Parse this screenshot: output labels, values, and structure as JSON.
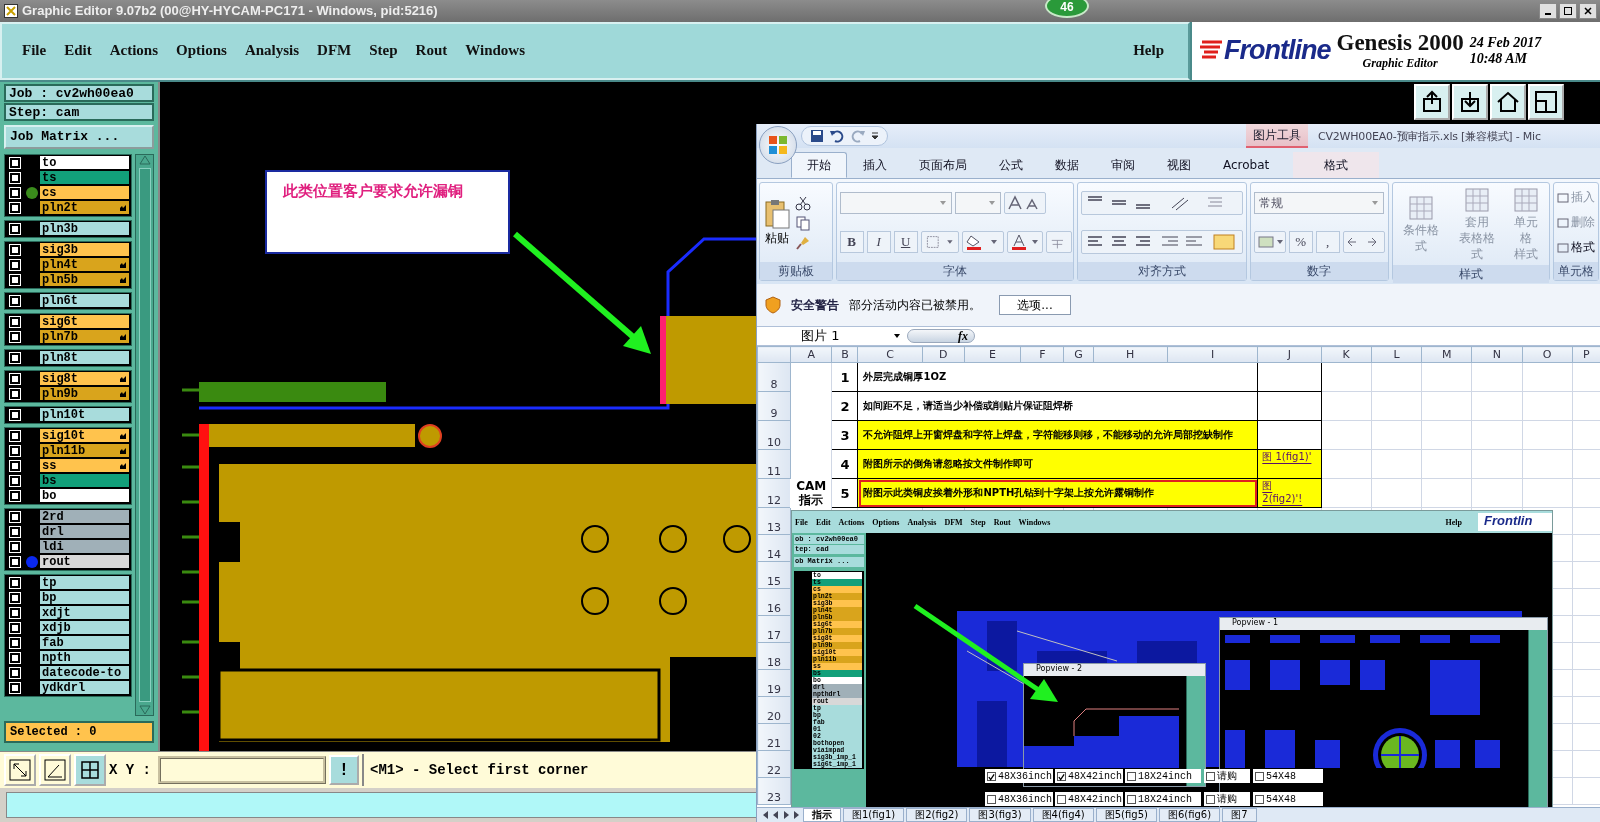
{
  "window": {
    "title": "Graphic Editor 9.07b2 (00@HY-HYCAM-PC171 - Windows, pid:5216)",
    "badge": "46"
  },
  "menu": [
    "File",
    "Edit",
    "Actions",
    "Options",
    "Analysis",
    "DFM",
    "Step",
    "Rout",
    "Windows"
  ],
  "help": "Help",
  "brand": {
    "logo": "Frontline",
    "product": "Genesis 2000",
    "subtitle": "Graphic Editor",
    "date": "24 Feb 2017",
    "time": "10:48 AM"
  },
  "job": "Job : cv2wh00ea0",
  "step": "Step: cam",
  "matrix_button": "Job Matrix ...",
  "layer_groups": [
    [
      {
        "name": "to",
        "color": "#ffffff",
        "checked": false,
        "flag": false
      },
      {
        "name": "ts",
        "color": "#12a07a",
        "checked": false,
        "flag": false
      },
      {
        "name": "cs",
        "color": "#ffc34d",
        "checked": false,
        "flag": false,
        "marker": {
          "color": "#3a8c1c"
        }
      },
      {
        "name": "pln2t",
        "color": "#d9a41c",
        "checked": false,
        "flag": true
      }
    ],
    [
      {
        "name": "pln3b",
        "color": "#a8dcdc",
        "checked": false,
        "flag": false
      }
    ],
    [
      {
        "name": "sig3b",
        "color": "#ffc34d",
        "checked": false,
        "flag": false
      },
      {
        "name": "pln4t",
        "color": "#d9a41c",
        "checked": false,
        "flag": true
      },
      {
        "name": "pln5b",
        "color": "#d9a41c",
        "checked": false,
        "flag": true
      }
    ],
    [
      {
        "name": "pln6t",
        "color": "#a8dcdc",
        "checked": false,
        "flag": false
      }
    ],
    [
      {
        "name": "sig6t",
        "color": "#ffc34d",
        "checked": false,
        "flag": false
      },
      {
        "name": "pln7b",
        "color": "#d9a41c",
        "checked": false,
        "flag": true
      }
    ],
    [
      {
        "name": "pln8t",
        "color": "#a8dcdc",
        "checked": false,
        "flag": false
      }
    ],
    [
      {
        "name": "sig8t",
        "color": "#ffc34d",
        "checked": false,
        "flag": true
      },
      {
        "name": "pln9b",
        "color": "#d9a41c",
        "checked": false,
        "flag": true
      }
    ],
    [
      {
        "name": "pln10t",
        "color": "#a8dcdc",
        "checked": false,
        "flag": false
      }
    ],
    [
      {
        "name": "sig10t",
        "color": "#ffc34d",
        "checked": false,
        "flag": true
      },
      {
        "name": "pln11b",
        "color": "#d9a41c",
        "checked": false,
        "flag": true
      },
      {
        "name": "ss",
        "color": "#ffc34d",
        "checked": false,
        "flag": true
      },
      {
        "name": "bs",
        "color": "#12a07a",
        "checked": false,
        "flag": false
      },
      {
        "name": "bo",
        "color": "#ffffff",
        "checked": false,
        "flag": false
      }
    ],
    [
      {
        "name": "2rd",
        "color": "#a0b0b8",
        "checked": false,
        "flag": false
      },
      {
        "name": "drl",
        "color": "#a0b0b8",
        "checked": false,
        "flag": false
      },
      {
        "name": "ldi",
        "color": "#a0b0b8",
        "checked": false,
        "flag": false
      },
      {
        "name": "rout",
        "color": "#d8d8d8",
        "checked": false,
        "flag": false,
        "marker": {
          "color": "#0a28f0"
        }
      }
    ],
    [
      {
        "name": "tp",
        "color": "#a8dcdc",
        "checked": false,
        "flag": false
      },
      {
        "name": "bp",
        "color": "#a8dcdc",
        "checked": false,
        "flag": false
      },
      {
        "name": "xdjt",
        "color": "#a8dcdc",
        "checked": false,
        "flag": false
      },
      {
        "name": "xdjb",
        "color": "#a8dcdc",
        "checked": false,
        "flag": false
      },
      {
        "name": "fab",
        "color": "#a8dcdc",
        "checked": false,
        "flag": false
      },
      {
        "name": "npth",
        "color": "#a8dcdc",
        "checked": false,
        "flag": false
      },
      {
        "name": "datecode-to",
        "color": "#a8dcdc",
        "checked": false,
        "flag": false
      },
      {
        "name": "ydkdrl",
        "color": "#a8dcdc",
        "checked": false,
        "flag": false
      }
    ]
  ],
  "selected_count": "Selected : 0",
  "annotation": "此类位置客户要求允许漏铜",
  "coord_label": "X Y :",
  "confirm": "!",
  "prompt": "<M1> - Select first corner",
  "excel": {
    "title": "CV2WH00EA0-预审指示.xls  [兼容模式] - Mic",
    "context_label": "图片工具",
    "tabs": [
      {
        "label": "开始",
        "selected": true,
        "context": false
      },
      {
        "label": "插入",
        "selected": false,
        "context": false
      },
      {
        "label": "页面布局",
        "selected": false,
        "context": false
      },
      {
        "label": "公式",
        "selected": false,
        "context": false
      },
      {
        "label": "数据",
        "selected": false,
        "context": false
      },
      {
        "label": "审阅",
        "selected": false,
        "context": false
      },
      {
        "label": "视图",
        "selected": false,
        "context": false
      },
      {
        "label": "Acrobat",
        "selected": false,
        "context": false
      },
      {
        "label": "格式",
        "selected": false,
        "context": true
      }
    ],
    "ribbon": {
      "paste": "粘贴",
      "bold": "B",
      "italic": "I",
      "underline": "U",
      "number_format": "常规",
      "percent": "%",
      "comma": ",",
      "styles": [
        {
          "lines": [
            "条件格式"
          ]
        },
        {
          "lines": [
            "套用",
            "表格格式"
          ]
        },
        {
          "lines": [
            "单元格",
            "样式"
          ]
        }
      ],
      "cells": [
        "插入",
        "删除",
        "格式"
      ],
      "groups": [
        "剪贴板",
        "字体",
        "对齐方式",
        "数字",
        "样式",
        "单元格"
      ]
    },
    "security": {
      "title": "安全警告",
      "message": "部分活动内容已被禁用。",
      "button": "选项..."
    },
    "name_box": "图片 1",
    "fx": "fx",
    "columns": [
      "A",
      "B",
      "C",
      "D",
      "E",
      "F",
      "G",
      "H",
      "I",
      "J",
      "K",
      "L",
      "M",
      "N",
      "O",
      "P"
    ],
    "rows": [
      {
        "number": "8",
        "index": "1",
        "text": "外层完成铜厚1OZ",
        "highlight": false,
        "framed": false
      },
      {
        "number": "9",
        "index": "2",
        "text": "如间距不足，请适当少补偿或削贴片保证阻焊桥",
        "highlight": false,
        "framed": false
      },
      {
        "number": "10",
        "index": "3",
        "text": "不允许阻焊上开窗焊盘和字符上焊盘，字符能移则移，不能移动的允许局部挖缺制作",
        "highlight": true,
        "framed": false
      },
      {
        "number": "11",
        "index": "4",
        "text": "附图所示的倒角请忽略按文件制作即可",
        "highlight": true,
        "framed": false,
        "link": "图 1(fig1)'"
      },
      {
        "number": "12",
        "index": "5",
        "text": "附图示此类铜皮挨着外形和NPTH孔钻到十字架上按允许露铜制作",
        "highlight": true,
        "framed": true,
        "link": "图 2(fig2)'!"
      }
    ],
    "cam_label": [
      "CAM",
      "指示"
    ],
    "more_rows": [
      "13",
      "14",
      "15",
      "16",
      "17",
      "18",
      "19",
      "20",
      "21",
      "22",
      "23"
    ],
    "sheet_tabs": [
      {
        "label": "指示",
        "selected": true
      },
      {
        "label": "图1(fig1)",
        "selected": false
      },
      {
        "label": "图2(fig2)",
        "selected": false
      },
      {
        "label": "图3(fig3)",
        "selected": false
      },
      {
        "label": "图4(fig4)",
        "selected": false
      },
      {
        "label": "图5(fig5)",
        "selected": false
      },
      {
        "label": "图6(fig6)",
        "selected": false
      },
      {
        "label": "图7",
        "selected": false
      }
    ],
    "picture": {
      "menus": [
        "File",
        "Edit",
        "Actions",
        "Options",
        "Analysis",
        "DFM",
        "Step",
        "Rout",
        "Windows"
      ],
      "help": "Help",
      "logo": "Frontlin",
      "job": "ob : cv2wh00ea0",
      "step": "tep: cad",
      "matrix": "ob Matrix ...",
      "layers": [
        {
          "name": "to",
          "color": "#ffffff"
        },
        {
          "name": "ts",
          "color": "#12a07a"
        },
        {
          "name": "cs",
          "color": "#ffc34d"
        },
        {
          "name": "pln2t",
          "color": "#d9a41c"
        },
        {
          "name": "sig3b",
          "color": "#ffc34d"
        },
        {
          "name": "pln4t",
          "color": "#d9a41c"
        },
        {
          "name": "pln5b",
          "color": "#d9a41c"
        },
        {
          "name": "sig6t",
          "color": "#ffc34d"
        },
        {
          "name": "pln7b",
          "color": "#d9a41c"
        },
        {
          "name": "sig8t",
          "color": "#ffc34d"
        },
        {
          "name": "pln9b",
          "color": "#d9a41c"
        },
        {
          "name": "sig10t",
          "color": "#ffc34d"
        },
        {
          "name": "pln11b",
          "color": "#d9a41c"
        },
        {
          "name": "ss",
          "color": "#ffc34d"
        },
        {
          "name": "bs",
          "color": "#12a07a"
        },
        {
          "name": "bo",
          "color": "#ffffff"
        },
        {
          "name": "drl",
          "color": "#a0b0b8"
        },
        {
          "name": "npthdrl",
          "color": "#a0b0b8"
        },
        {
          "name": "rout",
          "color": "#d8d8d8"
        },
        {
          "name": "tp",
          "color": "#a8dcdc"
        },
        {
          "name": "bp",
          "color": "#a8dcdc"
        },
        {
          "name": "fab",
          "color": "#a8dcdc"
        },
        {
          "name": "01",
          "color": "#a8dcdc"
        },
        {
          "name": "02",
          "color": "#a8dcdc"
        },
        {
          "name": "bothopen",
          "color": "#a8dcdc"
        },
        {
          "name": "viaimpad",
          "color": "#a8dcdc"
        },
        {
          "name": "sig3b_imp_1",
          "color": "#a8dcdc"
        },
        {
          "name": "sig6t_imp_1",
          "color": "#a8dcdc"
        }
      ],
      "popviews": [
        "Popview - 1",
        "Popview - 2"
      ],
      "size_rows": [
        [
          {
            "label": "48X36inch",
            "checked": true
          },
          {
            "label": "48X42inch",
            "checked": true
          },
          {
            "label": "18X24inch",
            "checked": false
          },
          {
            "label": "请购",
            "checked": false
          },
          {
            "label": "54X48",
            "checked": false
          }
        ],
        [
          {
            "label": "48X36inch",
            "checked": false
          },
          {
            "label": "48X42inch",
            "checked": false
          },
          {
            "label": "18X24inch",
            "checked": false
          },
          {
            "label": "请购",
            "checked": false
          },
          {
            "label": "54X48",
            "checked": false
          }
        ]
      ]
    }
  }
}
